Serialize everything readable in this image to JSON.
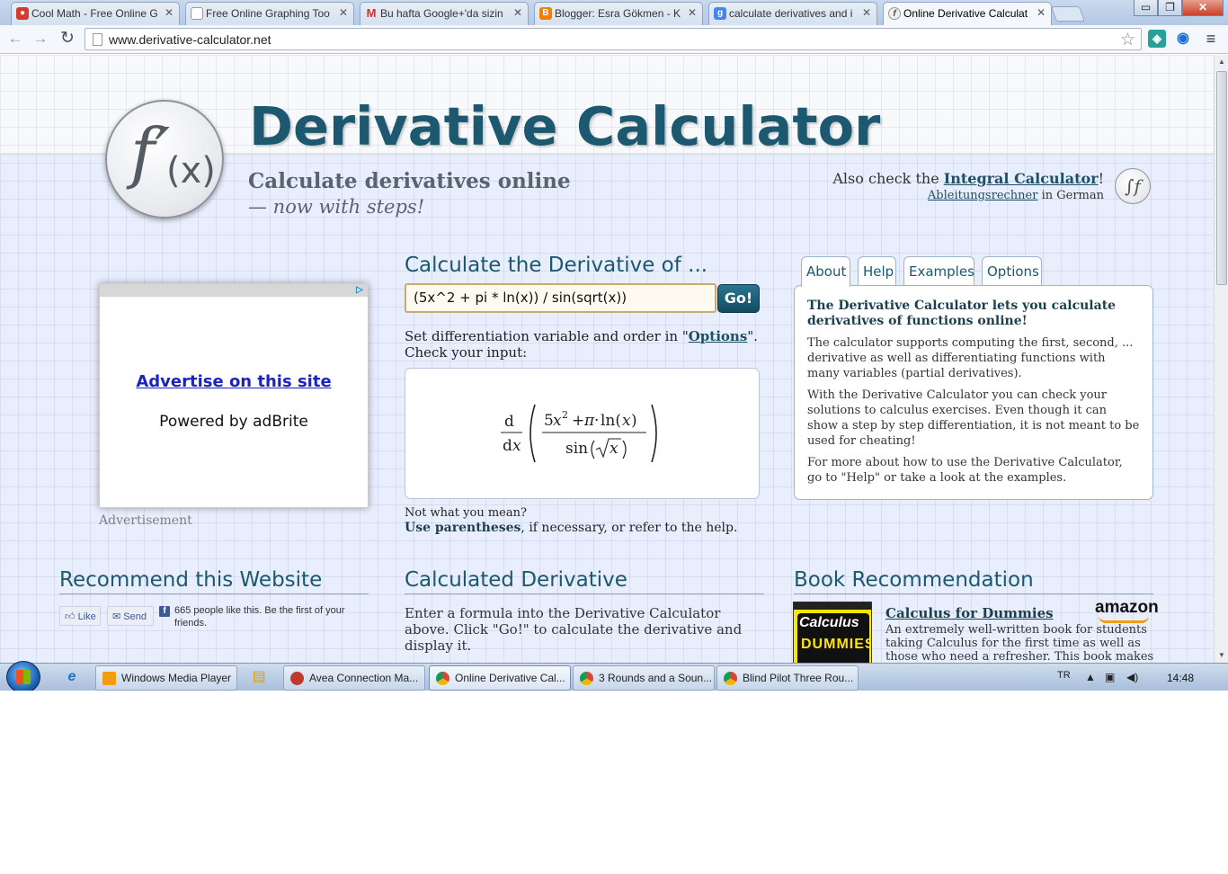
{
  "browser": {
    "tabs": [
      {
        "title": "Cool Math - Free Online G",
        "icon": "coolmath-icon",
        "color": "#d63a2a"
      },
      {
        "title": "Free Online Graphing Too",
        "icon": "page-icon",
        "color": "#ffffff"
      },
      {
        "title": "Bu hafta Google+'da sizin",
        "icon": "gmail-icon",
        "color": "#d93025"
      },
      {
        "title": "Blogger: Esra Gökmen - K",
        "icon": "blogger-icon",
        "color": "#f57d00"
      },
      {
        "title": "calculate derivatives and i",
        "icon": "google-icon",
        "color": "#4285f4"
      },
      {
        "title": "Online Derivative Calculat",
        "icon": "derivative-calculator-icon",
        "color": "#777777"
      }
    ],
    "url": "www.derivative-calculator.net",
    "window_buttons": {
      "minimize": "▭",
      "maximize": "❐",
      "close": "✕"
    }
  },
  "page": {
    "title": "Derivative Calculator",
    "subtitle": "Calculate derivatives online",
    "subtitle2": "— now with steps!",
    "also_check_prefix": "Also check the ",
    "integral_link": "Integral Calculator",
    "also_check_suffix": "!",
    "german_link": "Ableitungsrechner",
    "german_suffix": " in German",
    "ad": {
      "link": "Advertise on this site",
      "powered": "Powered by adBrite",
      "caption": "Advertisement"
    },
    "calc": {
      "heading": "Calculate the Derivative of ...",
      "input_value": "(5x^2 + pi * ln(x)) / sin(sqrt(x))",
      "go_label": "Go!",
      "diff_note_prefix": "Set differentiation variable and order in \"",
      "diff_note_link": "Options",
      "diff_note_suffix": "\".",
      "check_input": "Check your input:",
      "not_mean": "Not what you mean?",
      "use_paren_bold": "Use parentheses",
      "use_paren_rest": ", if necessary, or refer to the help."
    },
    "info": {
      "tabs": [
        "About",
        "Help",
        "Examples",
        "Options"
      ],
      "title": "The Derivative Calculator lets you calculate derivatives of functions online!",
      "p1": "The calculator supports computing the first, second, ... derivative as well as differentiating functions with many variables (partial derivatives).",
      "p2": "With the Derivative Calculator you can check your solutions to calculus exercises. Even though it can show a step by step differentiation, it is not meant to be used for cheating!",
      "p3": "For more about how to use the Derivative Calculator, go to \"Help\" or take a look at the examples."
    },
    "recommend": {
      "heading": "Recommend this Website",
      "like": "Like",
      "send": "Send",
      "count_text": "665 people like this. Be the first of your friends."
    },
    "derived": {
      "heading": "Calculated Derivative",
      "text": "Enter a formula into the Derivative Calculator above. Click \"Go!\" to calculate the derivative and display it."
    },
    "book": {
      "heading": "Book Recommendation",
      "title": "Calculus for Dummies",
      "cover_title": "Calculus",
      "cover_sub": "DUMMIES",
      "store": "amazon",
      "desc": "An extremely well-written book for students taking Calculus for the first time as well as those who need a refresher. This book makes you realize that"
    }
  },
  "taskbar": {
    "items": [
      {
        "label": "Windows Media Player",
        "icon": "media-player-icon",
        "color": "#f39c12"
      },
      {
        "label": "Avea Connection Ma...",
        "icon": "avea-icon",
        "color": "#c0392b"
      },
      {
        "label": "Online Derivative Cal...",
        "icon": "chrome-icon",
        "color": "#2e9e48"
      },
      {
        "label": "3 Rounds and a Soun...",
        "icon": "chrome-icon",
        "color": "#2e9e48"
      },
      {
        "label": "Blind Pilot Three Rou...",
        "icon": "chrome-icon",
        "color": "#2e9e48"
      }
    ],
    "lang": "TR",
    "clock": "14:48"
  }
}
